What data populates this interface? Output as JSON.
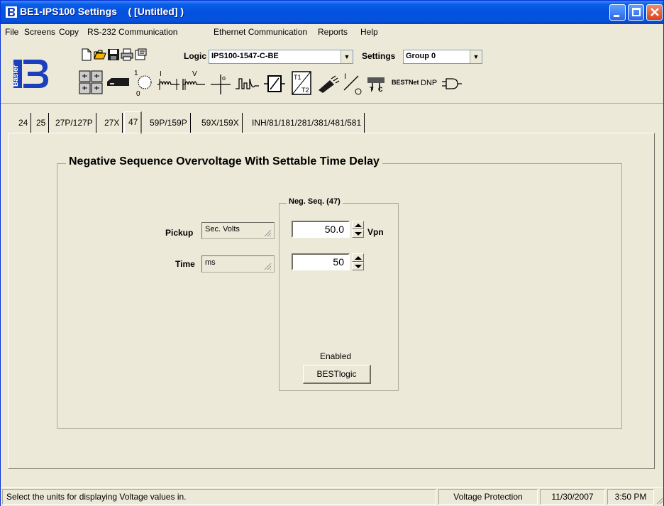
{
  "window": {
    "title": "BE1-IPS100 Settings    ( [Untitled] )"
  },
  "menu": {
    "items": [
      "File",
      "Screens",
      "Copy",
      "RS-232 Communication",
      "Ethernet Communication",
      "Reports",
      "Help"
    ]
  },
  "logo": {
    "text": "Basler"
  },
  "toolbar": {
    "logic_label": "Logic",
    "logic_value": "IPS100-1547-C-BE",
    "settings_label": "Settings",
    "settings_value": "Group 0",
    "bestnet_label": "BESTNet",
    "dnp_label": "DNP",
    "icons": [
      "new-file-icon",
      "open-folder-icon",
      "save-disk-icon",
      "print-icon",
      "properties-icon"
    ]
  },
  "tabs": {
    "items": [
      "24",
      "25",
      "27P/127P",
      "27X",
      "47",
      "59P/159P",
      "59X/159X",
      "INH/81/181/281/381/481/581"
    ],
    "active": "47"
  },
  "panel": {
    "group_title": "Negative Sequence Overvoltage With Settable Time Delay",
    "neg_seq_title": "Neg. Seq. (47)",
    "pickup_label": "Pickup",
    "pickup_units": "Sec. Volts",
    "pickup_value": "50.0",
    "pickup_unit_suffix": "Vpn",
    "time_label": "Time",
    "time_units": "ms",
    "time_value": "50",
    "enabled_label": "Enabled",
    "bestlogic_label": "BESTlogic"
  },
  "status": {
    "message": "Select the units for displaying Voltage values in.",
    "section": "Voltage Protection",
    "date": "11/30/2007",
    "time": "3:50 PM"
  },
  "colors": {
    "titlebar": "#0a5ee8",
    "face": "#ece9d8",
    "logo_blue": "#1a3fbf"
  }
}
